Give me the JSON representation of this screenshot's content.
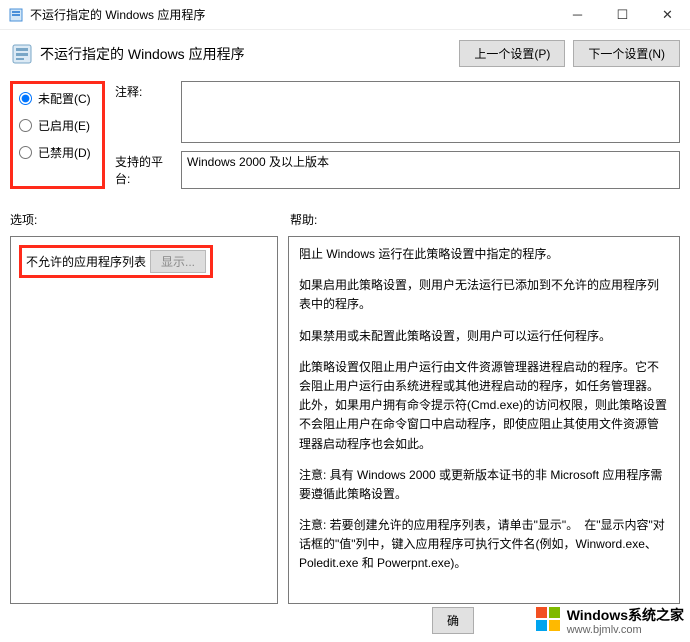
{
  "titlebar": {
    "title": "不运行指定的 Windows 应用程序"
  },
  "header": {
    "title": "不运行指定的 Windows 应用程序",
    "prev_setting": "上一个设置(P)",
    "next_setting": "下一个设置(N)"
  },
  "radios": {
    "not_configured": "未配置(C)",
    "enabled": "已启用(E)",
    "disabled": "已禁用(D)"
  },
  "labels": {
    "comment": "注释:",
    "supported": "支持的平台:",
    "options": "选项:",
    "help": "帮助:"
  },
  "fields": {
    "comment_value": "",
    "supported_value": "Windows 2000 及以上版本"
  },
  "options_panel": {
    "disallowed_list_label": "不允许的应用程序列表",
    "show_button": "显示..."
  },
  "help_text": {
    "p1": "阻止 Windows 运行在此策略设置中指定的程序。",
    "p2": "如果启用此策略设置，则用户无法运行已添加到不允许的应用程序列表中的程序。",
    "p3": "如果禁用或未配置此策略设置，则用户可以运行任何程序。",
    "p4": "此策略设置仅阻止用户运行由文件资源管理器进程启动的程序。它不会阻止用户运行由系统进程或其他进程启动的程序，如任务管理器。　此外，如果用户拥有命令提示符(Cmd.exe)的访问权限，则此策略设置不会阻止用户在命令窗口中启动程序，即使应阻止其使用文件资源管理器启动程序也会如此。",
    "p5": "注意: 具有 Windows 2000 或更新版本证书的非 Microsoft 应用程序需要遵循此策略设置。",
    "p6": "注意: 若要创建允许的应用程序列表，请单击\"显示\"。　在\"显示内容\"对话框的\"值\"列中，键入应用程序可执行文件名(例如，Winword.exe、Poledit.exe 和 Powerpnt.exe)。"
  },
  "buttons": {
    "ok": "确"
  },
  "watermark": {
    "brand": "Windows",
    "tagline": "系统之家",
    "url": "www.bjmlv.com"
  }
}
